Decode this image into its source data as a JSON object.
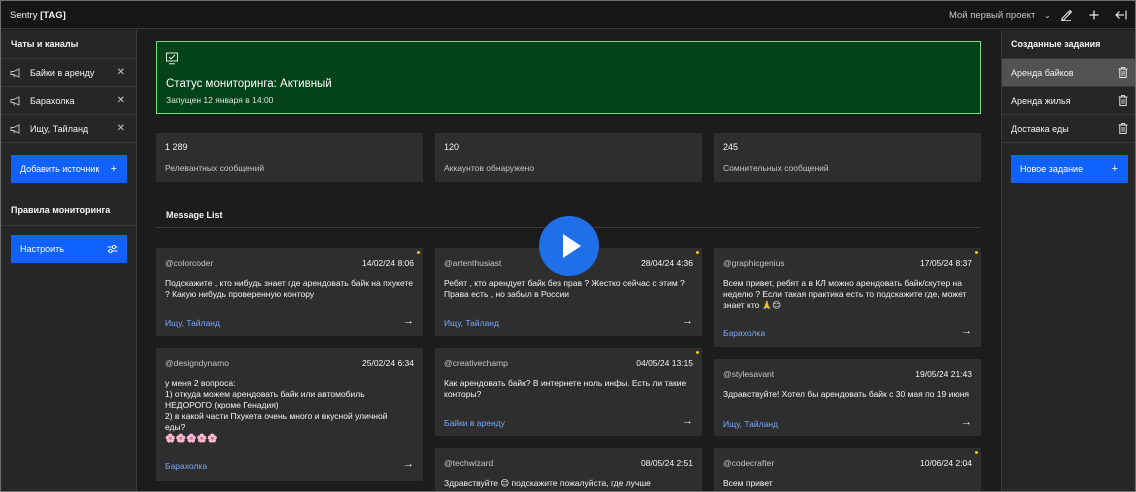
{
  "header": {
    "app_name": "Sentry",
    "app_tag": "[TAG]",
    "project": "Мой первый проект",
    "icons": [
      "chevron-down-icon",
      "edit-icon",
      "add-icon",
      "collapse-panel-icon"
    ]
  },
  "sidebar_left": {
    "sources_title": "Чаты и каналы",
    "sources": [
      {
        "label": "Байки в аренду"
      },
      {
        "label": "Барахолка"
      },
      {
        "label": "Ищу, Тайланд"
      }
    ],
    "add_source_label": "Добавить источник",
    "rules_title": "Правила мониторинга",
    "configure_label": "Настроить"
  },
  "status": {
    "title": "Статус мониторинга: Активный",
    "started": "Запущен 12 января в 14:00"
  },
  "stats": [
    {
      "value": "1 289",
      "label": "Релевантных сообщений"
    },
    {
      "value": "120",
      "label": "Аккаунтов обнаружено"
    },
    {
      "value": "245",
      "label": "Сомнительных сообщений"
    }
  ],
  "messages": {
    "title": "Message List",
    "items": [
      {
        "user": "@colorcoder",
        "date": "14/02/24 8:06",
        "text": "Подскажите , кто нибудь знает где арендовать байк на пхукете ? Какую нибудь проверенную контору",
        "tag": "Ищу, Тайланд",
        "unread": true
      },
      {
        "user": "@artenthusiast",
        "date": "28/04/24 4:36",
        "text": "Ребят , кто арендует байк без прав ? Жестко сейчас с этим ? Права есть , но забыл в России",
        "tag": "Ищу, Тайланд",
        "unread": true
      },
      {
        "user": "@graphicgenius",
        "date": "17/05/24 8:37",
        "text": "Всем привет, ребят а в КЛ можно арендовать байк/скутер на неделю ? Если такая практика есть то подскажите где, может знает кто 🙏😊",
        "tag": "Барахолка",
        "unread": true
      },
      {
        "user": "@designdynamo",
        "date": "25/02/24 6:34",
        "text": "у меня 2 вопроса:\n1) откуда можем арендовать байк или автомобиль НЕДОРОГО (кроме Генадия)\n2) в какой части Пхукета очень много и вкусной уличной еды?\n🌸🌸🌸🌸🌸",
        "tag": "Барахолка",
        "unread": false
      },
      {
        "user": "@creativechamp",
        "date": "04/05/24 13:15",
        "text": "Как арендовать байк? В интернете ноль инфы. Есть ли такие конторы?",
        "tag": "Байки в аренду",
        "unread": true
      },
      {
        "user": "@stylesavant",
        "date": "19/05/24 21:43",
        "text": "Здравствуйте! Хотел бы арендовать байк с 30 мая по 19 июня",
        "tag": "Ищу, Тайланд",
        "unread": false
      },
      {
        "user": "@techwizard",
        "date": "08/05/24 2:51",
        "text": "Здравствуйте 😊 подскажите пожалуйста, где лучше",
        "tag": "",
        "unread": false
      },
      {
        "user": "@codecrafter",
        "date": "10/06/24 2:04",
        "text": "Всем привет",
        "tag": "",
        "unread": true
      }
    ]
  },
  "sidebar_right": {
    "title": "Созданные задания",
    "tasks": [
      {
        "label": "Аренда байков",
        "active": true
      },
      {
        "label": "Аренда жилья",
        "active": false
      },
      {
        "label": "Доставка еды",
        "active": false
      }
    ],
    "new_task_label": "Новое задание"
  },
  "colors": {
    "accent": "#0f62fe",
    "status_bg": "#044317",
    "status_border": "#6fdc8c",
    "tag_link": "#78a9ff",
    "unread_dot": "#f1c21b"
  }
}
